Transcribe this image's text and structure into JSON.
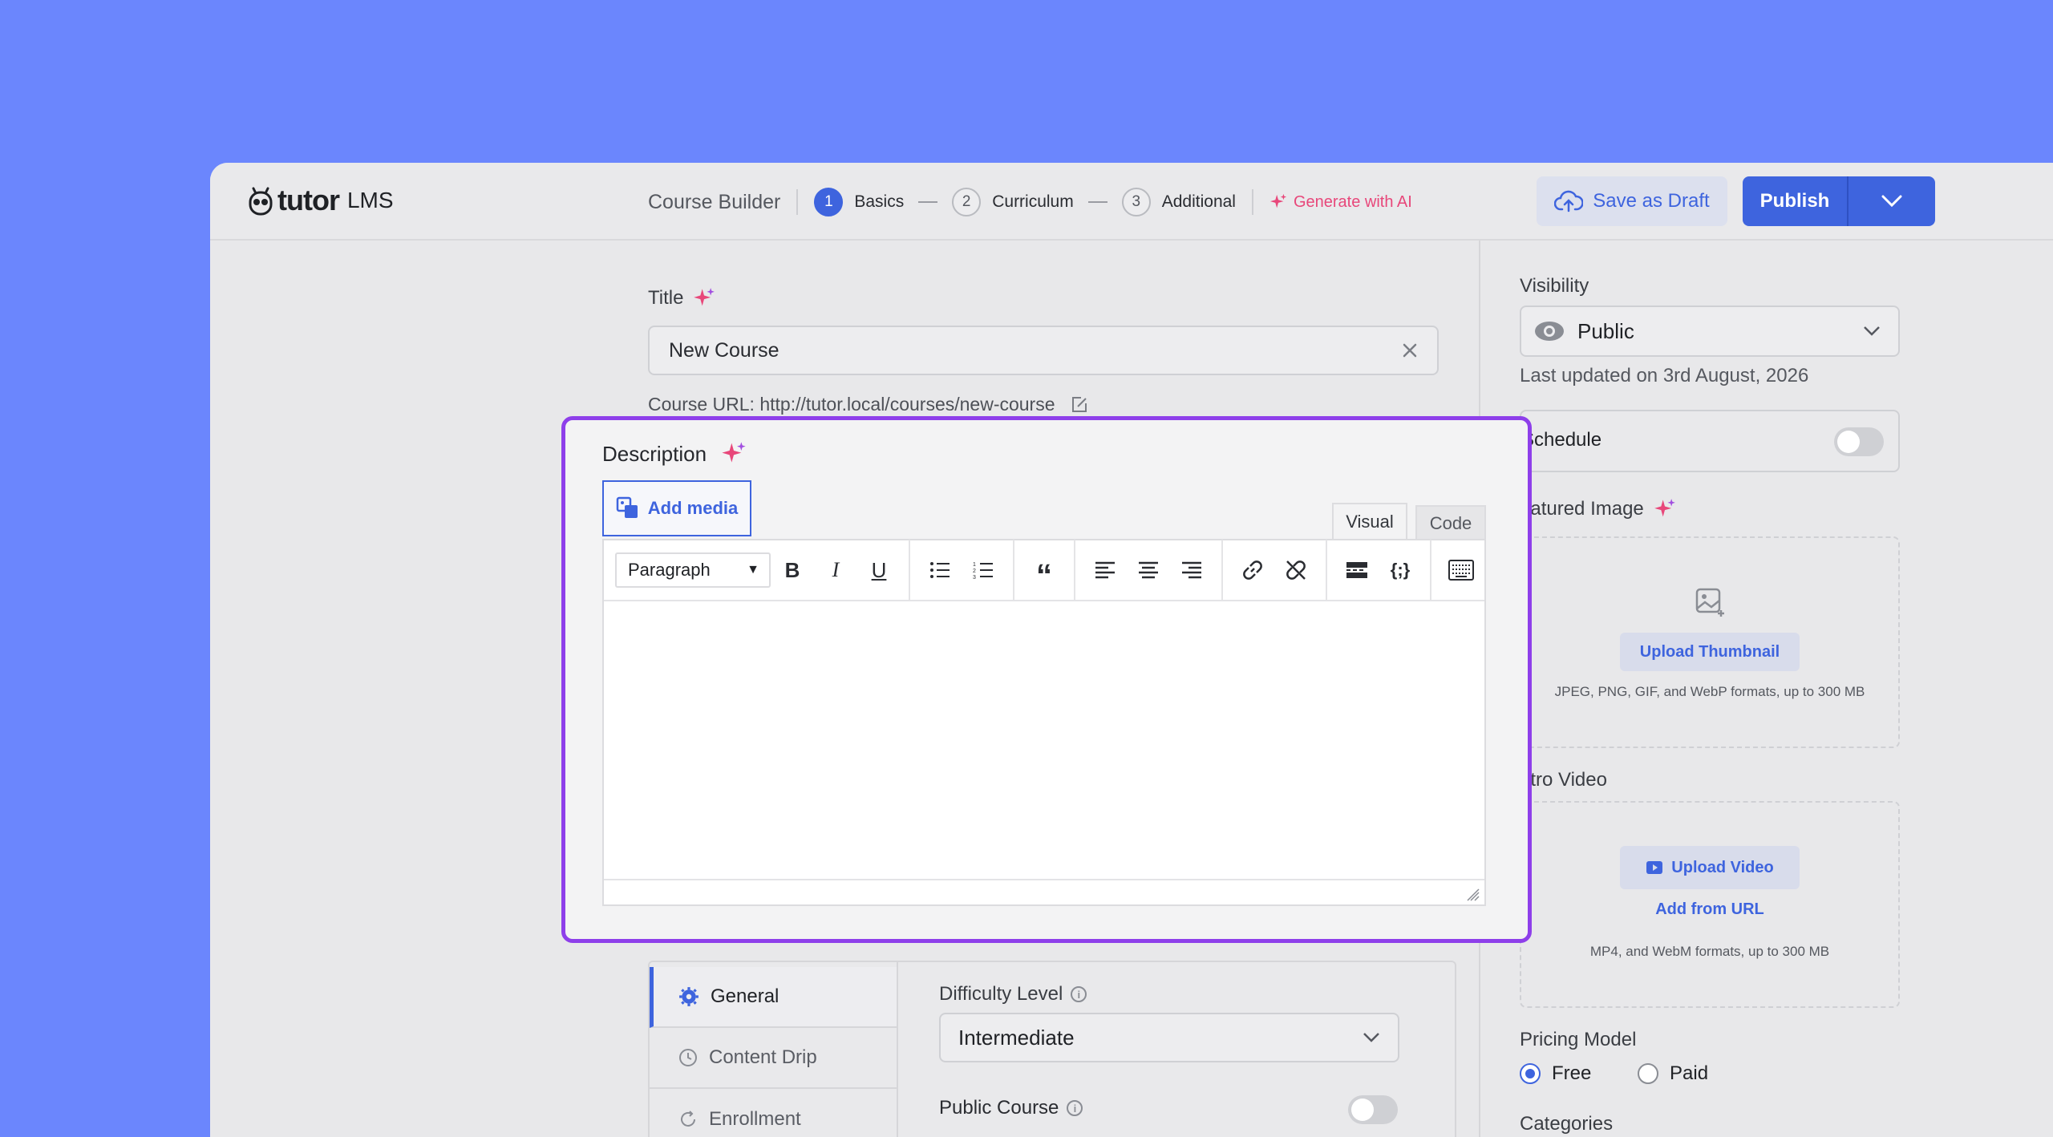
{
  "header": {
    "logo_word": "tutor",
    "logo_suffix": "LMS",
    "builder_label": "Course Builder",
    "steps": [
      {
        "num": "1",
        "label": "Basics"
      },
      {
        "num": "2",
        "label": "Curriculum"
      },
      {
        "num": "3",
        "label": "Additional"
      }
    ],
    "generate_ai": "Generate with AI",
    "save_draft": "Save as Draft",
    "publish": "Publish"
  },
  "title_field": {
    "label": "Title",
    "value": "New Course"
  },
  "course_url": {
    "label": "Course URL:",
    "url": "http://tutor.local/courses/new-course"
  },
  "description": {
    "label": "Description",
    "add_media": "Add media",
    "tab_visual": "Visual",
    "tab_code": "Code",
    "format_select": "Paragraph"
  },
  "settings": {
    "tabs": [
      "General",
      "Content Drip",
      "Enrollment"
    ],
    "difficulty_label": "Difficulty Level",
    "difficulty_value": "Intermediate",
    "public_course_label": "Public Course"
  },
  "sidebar": {
    "visibility_label": "Visibility",
    "visibility_value": "Public",
    "last_updated": "Last updated on 3rd August, 2026",
    "schedule_label": "Schedule",
    "featured_label": "eatured Image",
    "upload_thumbnail": "Upload Thumbnail",
    "thumbnail_hint": "JPEG, PNG, GIF, and WebP formats, up to 300 MB",
    "intro_label": "ntro Video",
    "upload_video": "Upload Video",
    "add_from_url": "Add from URL",
    "video_hint": "MP4, and WebM formats, up to 300 MB",
    "pricing_label": "Pricing Model",
    "pricing_free": "Free",
    "pricing_paid": "Paid",
    "categories_label": "Categories"
  },
  "colors": {
    "accent": "#3E64DE",
    "highlight": "#8E3FEA",
    "ai": "#E8477A",
    "background": "#6B86FD"
  }
}
